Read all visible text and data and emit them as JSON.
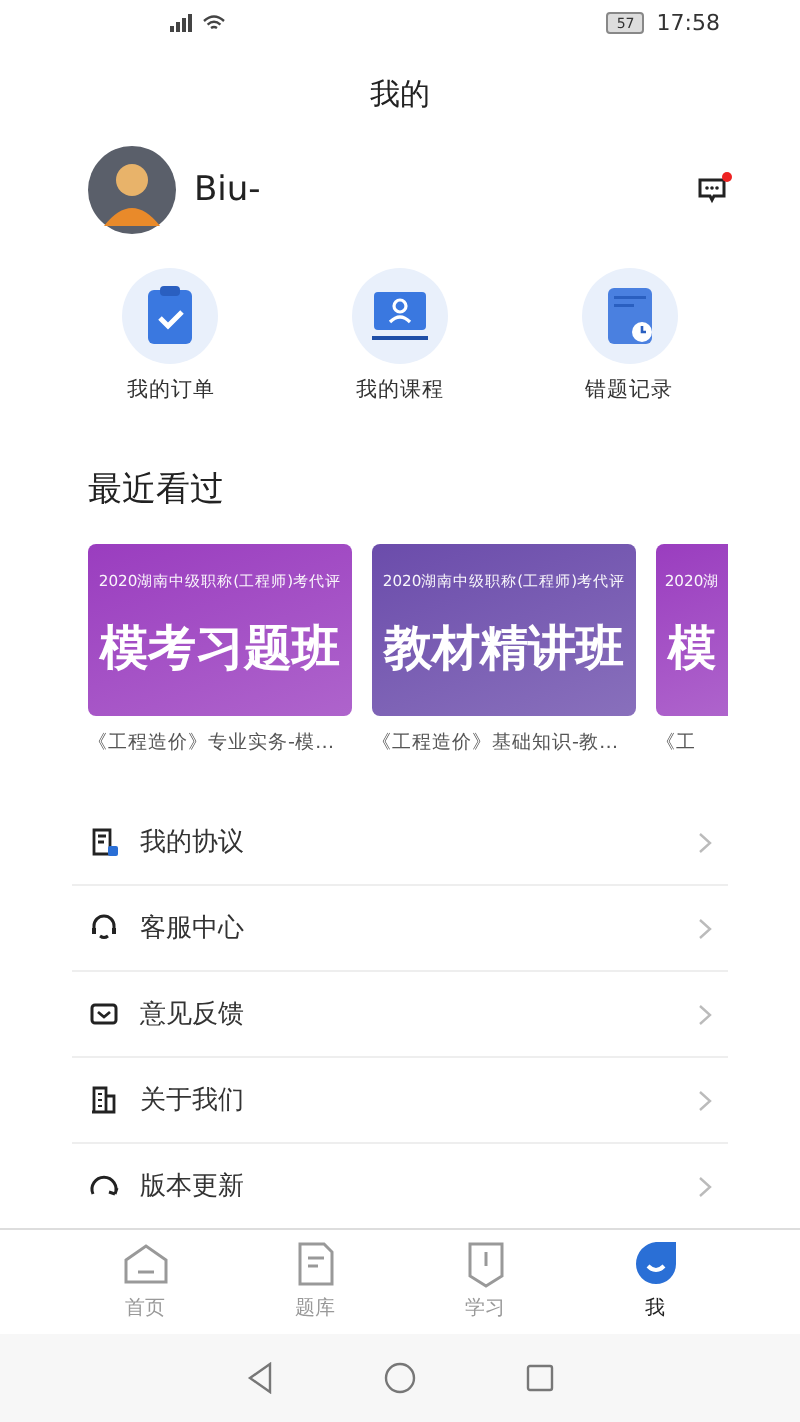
{
  "status_bar": {
    "battery": "57",
    "time": "17:58"
  },
  "title": "我的",
  "profile": {
    "name": "Biu-",
    "has_unread": true
  },
  "shortcuts": [
    {
      "label": "我的订单",
      "kind": "orders"
    },
    {
      "label": "我的课程",
      "kind": "courses"
    },
    {
      "label": "错题记录",
      "kind": "mistakes"
    }
  ],
  "recent": {
    "heading": "最近看过",
    "courses": [
      {
        "subtitle": "2020湖南中级职称(工程师)考代评",
        "title": "模考习题班",
        "caption": "《工程造价》专业实务-模…",
        "color": "#9a3dbf"
      },
      {
        "subtitle": "2020湖南中级职称(工程师)考代评",
        "title": "教材精讲班",
        "caption": "《工程造价》基础知识-教…",
        "color": "#6b4cab"
      },
      {
        "subtitle": "2020湖",
        "title": "模",
        "caption": "《工",
        "color": "#9a3dbf"
      }
    ]
  },
  "menu": [
    {
      "label": "我的协议",
      "kind": "agreement"
    },
    {
      "label": "客服中心",
      "kind": "service"
    },
    {
      "label": "意见反馈",
      "kind": "feedback"
    },
    {
      "label": "关于我们",
      "kind": "about"
    },
    {
      "label": "版本更新",
      "kind": "update"
    }
  ],
  "tabs": [
    {
      "label": "首页",
      "kind": "home",
      "selected": false
    },
    {
      "label": "题库",
      "kind": "bank",
      "selected": false
    },
    {
      "label": "学习",
      "kind": "study",
      "selected": false
    },
    {
      "label": "我",
      "kind": "me",
      "selected": true
    }
  ]
}
